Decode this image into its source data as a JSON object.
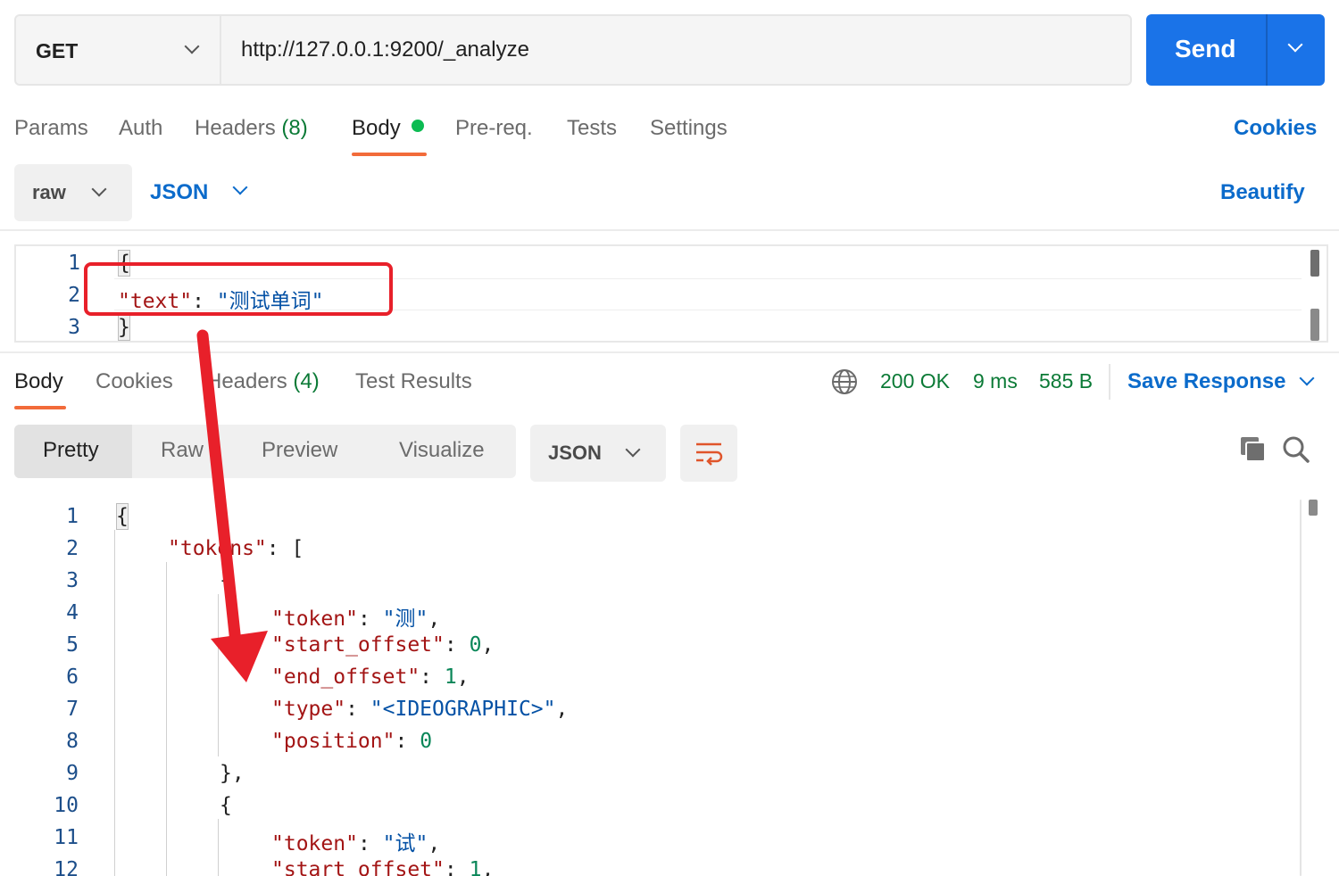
{
  "request": {
    "method": "GET",
    "url": "http://127.0.0.1:9200/_analyze",
    "send_label": "Send"
  },
  "request_tabs": {
    "params": "Params",
    "auth": "Auth",
    "headers": "Headers",
    "headers_count": "(8)",
    "body": "Body",
    "prereq": "Pre-req.",
    "tests": "Tests",
    "settings": "Settings",
    "cookies": "Cookies"
  },
  "body_options": {
    "mode": "raw",
    "language": "JSON",
    "beautify": "Beautify"
  },
  "request_body": {
    "line_numbers": [
      "1",
      "2",
      "3"
    ],
    "open_brace": "{",
    "key": "\"text\"",
    "colon": ": ",
    "value": "\"测试单词\"",
    "close_brace": "}"
  },
  "response_tabs": {
    "body": "Body",
    "cookies": "Cookies",
    "headers": "Headers",
    "headers_count": "(4)",
    "test_results": "Test Results"
  },
  "response_status": {
    "code": "200 OK",
    "time": "9 ms",
    "size": "585 B",
    "save": "Save Response"
  },
  "view_modes": {
    "pretty": "Pretty",
    "raw": "Raw",
    "preview": "Preview",
    "visualize": "Visualize",
    "format": "JSON"
  },
  "response_body": {
    "line_numbers": [
      "1",
      "2",
      "3",
      "4",
      "5",
      "6",
      "7",
      "8",
      "9",
      "10",
      "11",
      "12"
    ],
    "l1": "{",
    "l2_key": "\"tokens\"",
    "l2_rest": ": [",
    "l3": "{",
    "l4_key": "\"token\"",
    "l4_val": "\"测\"",
    "l5_key": "\"start_offset\"",
    "l5_val": "0",
    "l6_key": "\"end_offset\"",
    "l6_val": "1",
    "l7_key": "\"type\"",
    "l7_val": "\"<IDEOGRAPHIC>\"",
    "l8_key": "\"position\"",
    "l8_val": "0",
    "l9": "},",
    "l10": "{",
    "l11_key": "\"token\"",
    "l11_val": "\"试\"",
    "l12_key": "\"start_offset\"",
    "l12_val": "1",
    "colon": ": ",
    "comma": ","
  },
  "annotation": {
    "color": "#e8202a"
  },
  "colors": {
    "send": "#1a73e8",
    "link": "#0b6bcb",
    "status_ok": "#0b7a36",
    "tab_underline": "#f26b3a",
    "body_dot": "#0cbb52"
  },
  "icons": {
    "method_dropdown": "chevron-down-icon",
    "send_dropdown": "chevron-down-icon",
    "globe": "globe-icon",
    "wrap": "wrap-lines-icon",
    "copy": "copy-icon",
    "search": "search-icon"
  }
}
